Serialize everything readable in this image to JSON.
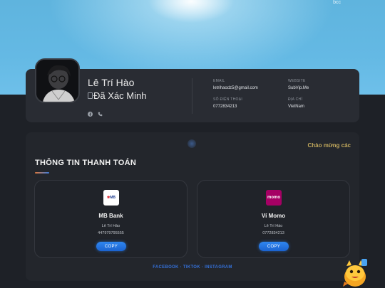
{
  "header": {
    "image_alt": "bcc"
  },
  "profile": {
    "name": "Lê Trí Hào",
    "verified_alt": "Đã Xác Minh",
    "social_icons": [
      "facebook-icon",
      "phone-icon"
    ],
    "email_label": "EMAIL",
    "email": "letrihaodz5@gmail.com",
    "website_label": "WEBSITE",
    "website": "SubVip.Me",
    "phone_label": "SỐ ĐIỆN THOẠI",
    "phone": "0772834213",
    "address_label": "ĐỊA CHỈ",
    "address": "VietNam"
  },
  "payment": {
    "welcome": "Chào mừng các",
    "title": "THÔNG TIN THANH TOÁN",
    "banks": [
      {
        "logo_text": "MB",
        "name": "MB Bank",
        "holder": "Lê Trí Hào",
        "account": "447979795555",
        "copy_label": "COPY"
      },
      {
        "logo_text": "momo",
        "name": "Ví Momo",
        "holder": "Lê Trí Hào",
        "account": "0772834213",
        "copy_label": "COPY"
      }
    ]
  },
  "footer": {
    "links": "FACEBOOK · TIKTOK · INSTAGRAM"
  },
  "colors": {
    "accent_blue": "#2f86f0",
    "gold": "#c1a85c",
    "momo_pink": "#a50064",
    "card_bg": "#292c33"
  }
}
